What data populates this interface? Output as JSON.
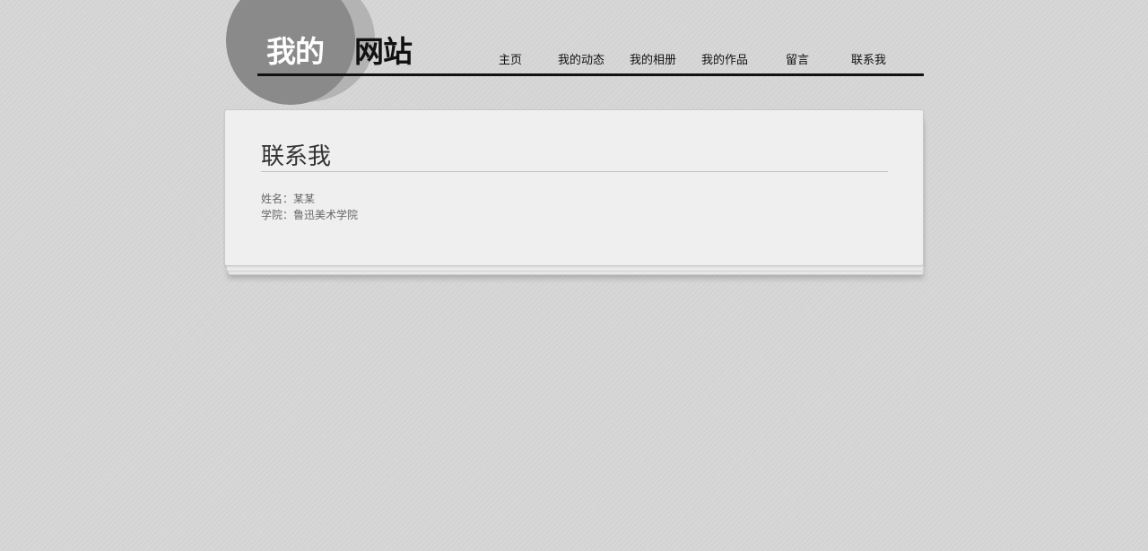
{
  "site": {
    "logo_white": "我的",
    "logo_black": "网站"
  },
  "nav": {
    "items": [
      {
        "label": "主页"
      },
      {
        "label": "我的动态"
      },
      {
        "label": "我的相册"
      },
      {
        "label": "我的作品"
      },
      {
        "label": "留言"
      },
      {
        "label": "联系我"
      }
    ]
  },
  "content": {
    "title": "联系我",
    "name_line": "姓名：某某",
    "school_line": "学院：鲁迅美术学院"
  }
}
